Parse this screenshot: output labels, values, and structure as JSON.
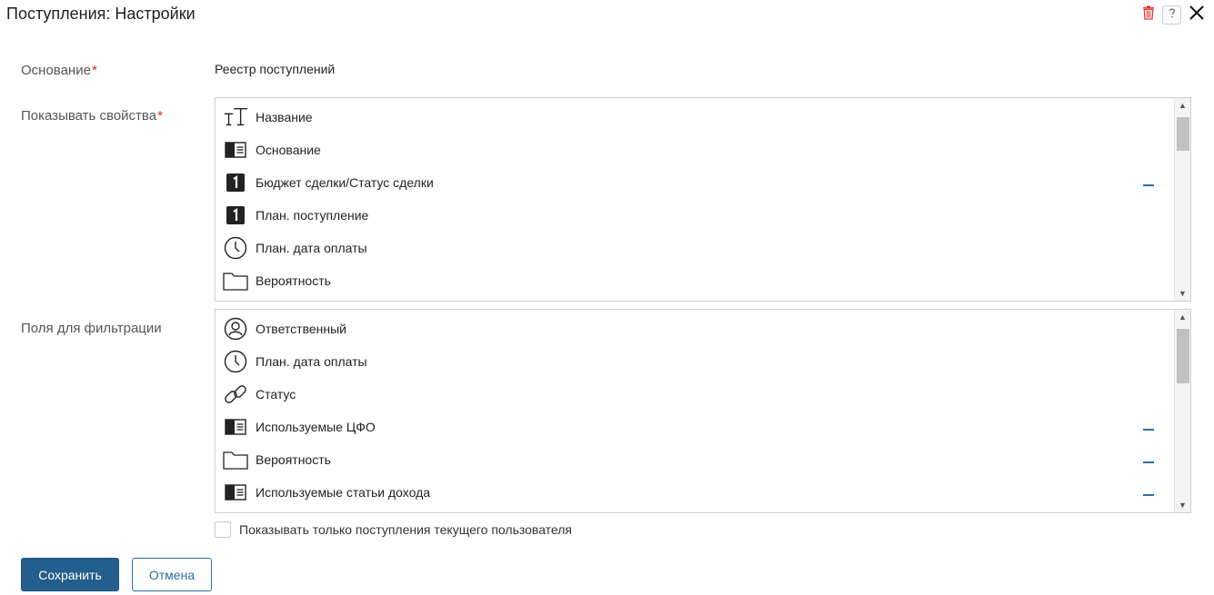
{
  "window": {
    "title": "Поступления: Настройки"
  },
  "header_actions": [
    {
      "name": "delete-button",
      "icon": "trash-icon",
      "color": "#e53935"
    },
    {
      "name": "help-button",
      "icon": "help-icon"
    },
    {
      "name": "close-button",
      "icon": "close-icon"
    }
  ],
  "form": {
    "basis": {
      "label": "Основание",
      "required_mark": "*",
      "value": "Реестр поступлений"
    },
    "show_properties": {
      "label": "Показывать свойства",
      "required_mark": "*",
      "items": [
        {
          "label": "Название",
          "icon": "text-type-icon",
          "has_dash": false
        },
        {
          "label": "Основание",
          "icon": "document-icon",
          "has_dash": false
        },
        {
          "label": "Бюджет сделки/Статус сделки",
          "icon": "number-icon",
          "has_dash": true
        },
        {
          "label": "План. поступление",
          "icon": "number-icon",
          "has_dash": false
        },
        {
          "label": "План. дата оплаты",
          "icon": "clock-icon",
          "has_dash": false
        },
        {
          "label": "Вероятность",
          "icon": "folder-icon",
          "has_dash": false
        }
      ]
    },
    "filter_fields": {
      "label": "Поля для фильтрации",
      "items": [
        {
          "label": "Ответственный",
          "icon": "user-icon",
          "has_dash": false
        },
        {
          "label": "План. дата оплаты",
          "icon": "clock-icon",
          "has_dash": false
        },
        {
          "label": "Статус",
          "icon": "link-icon",
          "has_dash": false
        },
        {
          "label": "Используемые ЦФО",
          "icon": "document-icon",
          "has_dash": true
        },
        {
          "label": "Вероятность",
          "icon": "folder-icon",
          "has_dash": true
        },
        {
          "label": "Используемые статьи дохода",
          "icon": "document-icon",
          "has_dash": true
        }
      ]
    },
    "current_user_only": {
      "label": "Показывать только поступления текущего пользователя",
      "checked": false
    }
  },
  "buttons": {
    "save": "Сохранить",
    "cancel": "Отмена"
  },
  "colors": {
    "primary": "#235e8c",
    "accent": "#2d6ea3",
    "required": "#d12b2b",
    "danger": "#e53935"
  }
}
